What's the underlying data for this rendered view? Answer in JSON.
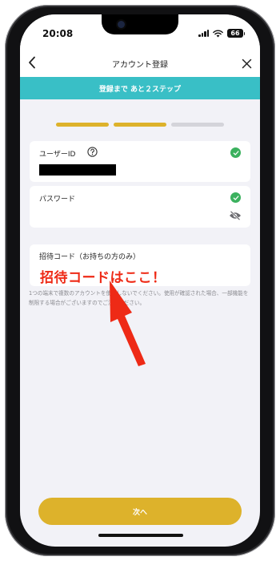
{
  "status_bar": {
    "time": "20:08",
    "battery": "66",
    "icons": [
      "signal-icon",
      "wifi-icon",
      "battery-icon"
    ]
  },
  "nav": {
    "title": "アカウント登録",
    "back_icon": "chevron-left-icon",
    "close_icon": "close-icon"
  },
  "banner": {
    "text": "登録まで あと２ステップ"
  },
  "progress": {
    "total_steps": 3,
    "completed_steps": 2,
    "active_color": "#ddb22b",
    "inactive_color": "#d4d4da"
  },
  "fields": {
    "user_id": {
      "label": "ユーザーID",
      "help_icon": "help-icon",
      "value_masked": true,
      "valid": true
    },
    "password": {
      "label": "パスワード",
      "valid": true,
      "visibility_icon": "eye-slash-icon"
    },
    "invite_code": {
      "label": "招待コード（お持ちの方のみ）",
      "value": ""
    }
  },
  "notice": "1つの端末で複数のアカウントを使用しないでください。使用が確認された場合、一部機能を制限する場合がございますのでご注意ください。",
  "annotation": {
    "text": "招待コードはここ！",
    "color": "#ee2a16"
  },
  "buttons": {
    "next_label": "次へ"
  },
  "colors": {
    "accent_teal": "#39bfc6",
    "accent_gold": "#ddb22b",
    "valid_green": "#3bb15e"
  }
}
